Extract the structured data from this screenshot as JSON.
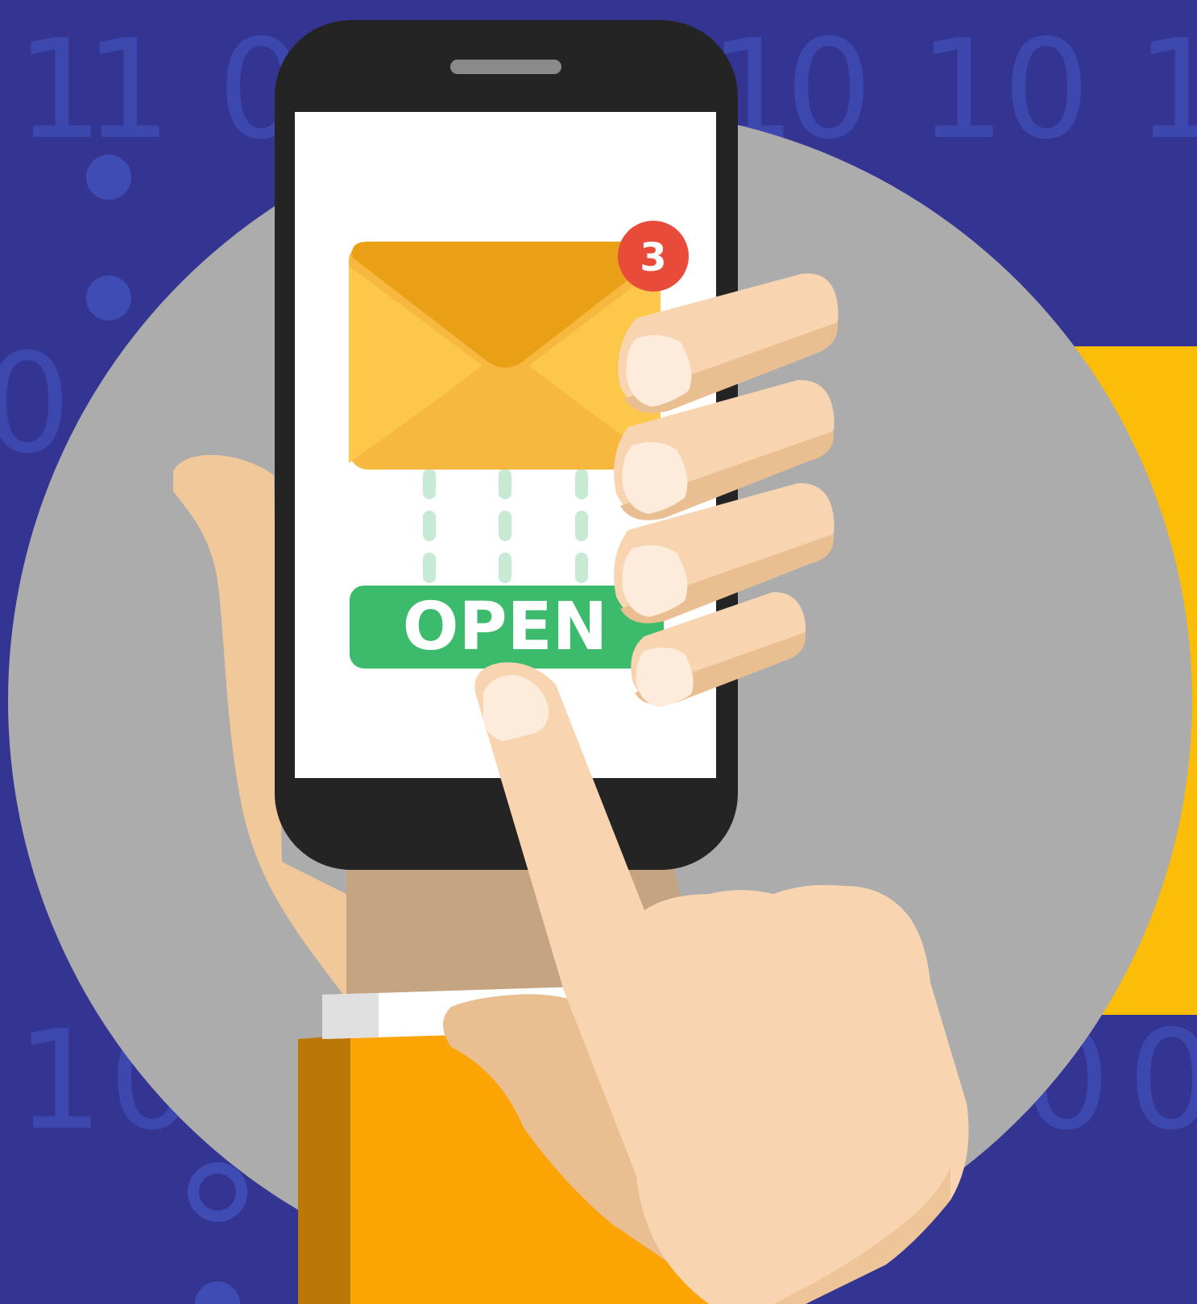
{
  "illustration": {
    "notification_count": "3",
    "open_button_label": "OPEN",
    "background_digits": {
      "top_row": [
        "1",
        "1",
        "0",
        "1",
        "0",
        "1",
        "0",
        "1",
        "1"
      ],
      "left_column": [
        "0"
      ],
      "bottom_row": [
        "1",
        "0",
        "0",
        "0"
      ]
    }
  },
  "colors": {
    "background": "#343592",
    "digits": "#3f4cb3",
    "circle": "#acacac",
    "yellow_bar": "#fbbd08",
    "phone_body": "#242424",
    "screen": "#ffffff",
    "envelope_back": "#f6b83f",
    "envelope_flap": "#eaa016",
    "envelope_side": "#fdc84a",
    "badge": "#e84b3a",
    "open_button": "#3dbb6c",
    "dashes": "#c6ead4",
    "skin": "#f8d5b0",
    "skin_shadow": "#e9be90",
    "nail": "#fdebdb",
    "sleeve": "#fca404",
    "sleeve_shadow": "#bb7806",
    "cuff": "#ffffff"
  },
  "icons": [
    "envelope-icon",
    "notification-badge",
    "hand-icon",
    "phone-icon"
  ]
}
